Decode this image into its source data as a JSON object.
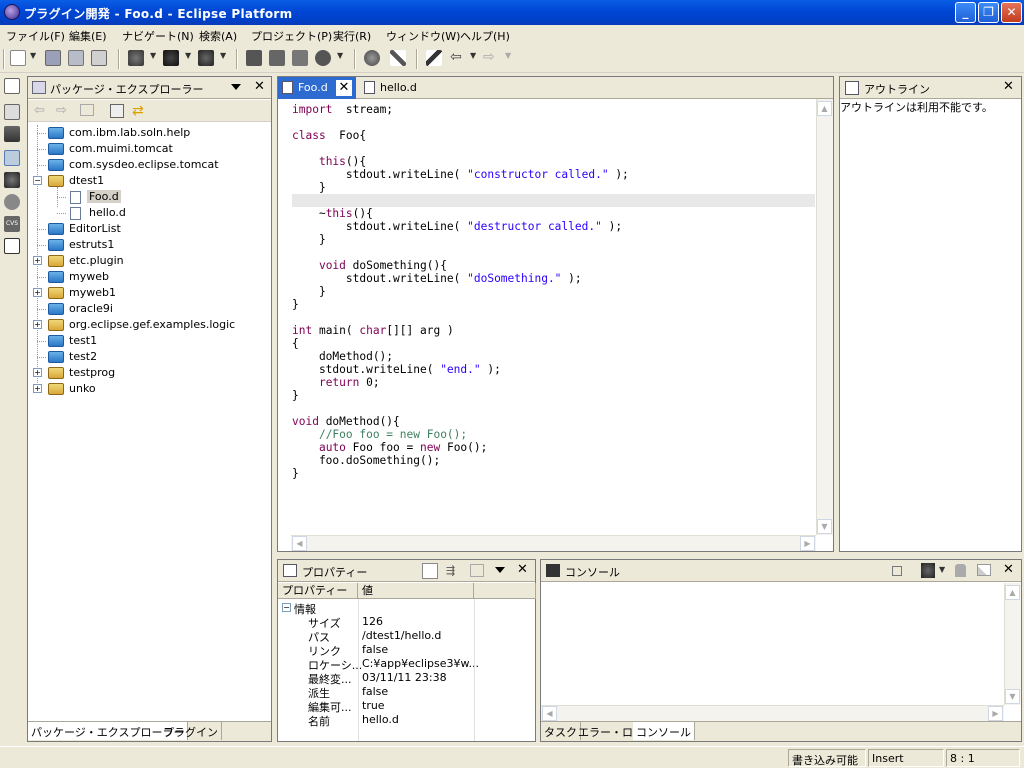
{
  "window": {
    "title": "プラグイン開発 - Foo.d - Eclipse Platform"
  },
  "menu": [
    "ファイル(F)",
    "編集(E)",
    "ナビゲート(N)",
    "検索(A)",
    "プロジェクト(P)",
    "実行(R)",
    "ウィンドウ(W)",
    "ヘルプ(H)"
  ],
  "explorer": {
    "title": "パッケージ・エクスプローラー",
    "items": [
      {
        "label": "com.ibm.lab.soln.help",
        "level": 0,
        "expand": "",
        "icon": "folder-icon"
      },
      {
        "label": "com.muimi.tomcat",
        "level": 0,
        "expand": "",
        "icon": "folder-icon"
      },
      {
        "label": "com.sysdeo.eclipse.tomcat",
        "level": 0,
        "expand": "",
        "icon": "folder-icon"
      },
      {
        "label": "dtest1",
        "level": 0,
        "expand": "−",
        "icon": "open-folder-icon"
      },
      {
        "label": "Foo.d",
        "level": 1,
        "expand": "",
        "icon": "file-icon",
        "selected": true
      },
      {
        "label": "hello.d",
        "level": 1,
        "expand": "",
        "icon": "file-icon"
      },
      {
        "label": "EditorList",
        "level": 0,
        "expand": "",
        "icon": "folder-icon"
      },
      {
        "label": "estruts1",
        "level": 0,
        "expand": "",
        "icon": "folder-icon"
      },
      {
        "label": "etc.plugin",
        "level": 0,
        "expand": "+",
        "icon": "java-project-icon"
      },
      {
        "label": "myweb",
        "level": 0,
        "expand": "",
        "icon": "folder-icon"
      },
      {
        "label": "myweb1",
        "level": 0,
        "expand": "+",
        "icon": "java-project-icon"
      },
      {
        "label": "oracle9i",
        "level": 0,
        "expand": "",
        "icon": "folder-icon"
      },
      {
        "label": "org.eclipse.gef.examples.logic",
        "level": 0,
        "expand": "+",
        "icon": "java-project-icon"
      },
      {
        "label": "test1",
        "level": 0,
        "expand": "",
        "icon": "folder-icon"
      },
      {
        "label": "test2",
        "level": 0,
        "expand": "",
        "icon": "folder-icon"
      },
      {
        "label": "testprog",
        "level": 0,
        "expand": "+",
        "icon": "java-project-icon"
      },
      {
        "label": "unko",
        "level": 0,
        "expand": "+",
        "icon": "java-project-icon"
      }
    ],
    "tabs": [
      "パッケージ・エクスプローラー",
      "プラグイン"
    ]
  },
  "editor": {
    "tabs": [
      {
        "label": "Foo.d",
        "active": true
      },
      {
        "label": "hello.d",
        "active": false
      }
    ],
    "lines": [
      [
        [
          "kw",
          "import"
        ],
        [
          "",
          "  stream;"
        ]
      ],
      [],
      [
        [
          "kw",
          "class"
        ],
        [
          "",
          "  Foo{"
        ]
      ],
      [],
      [
        [
          "",
          "    "
        ],
        [
          "kw",
          "this"
        ],
        [
          "",
          "(){"
        ]
      ],
      [
        [
          "",
          "        stdout.writeLine( "
        ],
        [
          "str",
          "\"constructor called.\""
        ],
        [
          "",
          " );"
        ]
      ],
      [
        [
          "",
          "    }"
        ]
      ],
      [],
      [
        [
          "",
          "    ~"
        ],
        [
          "kw",
          "this"
        ],
        [
          "",
          "(){"
        ]
      ],
      [
        [
          "",
          "        stdout.writeLine( "
        ],
        [
          "str",
          "\"destructor called.\""
        ],
        [
          "",
          " );"
        ]
      ],
      [
        [
          "",
          "    }"
        ]
      ],
      [],
      [
        [
          "",
          "    "
        ],
        [
          "kw",
          "void"
        ],
        [
          "",
          " doSomething(){"
        ]
      ],
      [
        [
          "",
          "        stdout.writeLine( "
        ],
        [
          "str",
          "\"doSomething.\""
        ],
        [
          "",
          " );"
        ]
      ],
      [
        [
          "",
          "    }"
        ]
      ],
      [
        [
          "",
          "}"
        ]
      ],
      [],
      [
        [
          "kw",
          "int"
        ],
        [
          "",
          " main( "
        ],
        [
          "kw",
          "char"
        ],
        [
          "",
          "[][] arg )"
        ]
      ],
      [
        [
          "",
          "{"
        ]
      ],
      [
        [
          "",
          "    doMethod();"
        ]
      ],
      [
        [
          "",
          "    stdout.writeLine( "
        ],
        [
          "str",
          "\"end.\""
        ],
        [
          "",
          " );"
        ]
      ],
      [
        [
          "",
          "    "
        ],
        [
          "kw",
          "return"
        ],
        [
          "",
          " 0;"
        ]
      ],
      [
        [
          "",
          "}"
        ]
      ],
      [],
      [
        [
          "kw",
          "void"
        ],
        [
          "",
          " doMethod(){"
        ]
      ],
      [
        [
          "",
          "    "
        ],
        [
          "cmt",
          "//Foo foo = new Foo();"
        ]
      ],
      [
        [
          "",
          "    "
        ],
        [
          "kw",
          "auto"
        ],
        [
          "",
          " Foo foo = "
        ],
        [
          "kw",
          "new"
        ],
        [
          "",
          " Foo();"
        ]
      ],
      [
        [
          "",
          "    foo.doSomething();"
        ]
      ],
      [
        [
          "",
          "}"
        ]
      ]
    ],
    "current_line": 7
  },
  "outline": {
    "title": "アウトライン",
    "message": "アウトラインは利用不能です。"
  },
  "properties": {
    "title": "プロパティー",
    "col_prop": "プロパティー",
    "col_value": "値",
    "group": "情報",
    "rows": [
      {
        "name": "サイズ",
        "value": "126"
      },
      {
        "name": "パス",
        "value": "/dtest1/hello.d"
      },
      {
        "name": "リンク",
        "value": "false"
      },
      {
        "name": "ロケーシ...",
        "value": "C:¥app¥eclipse3¥w..."
      },
      {
        "name": "最終変...",
        "value": "03/11/11 23:38"
      },
      {
        "name": "派生",
        "value": "false"
      },
      {
        "name": "編集可...",
        "value": "true"
      },
      {
        "name": "名前",
        "value": "hello.d"
      }
    ]
  },
  "console": {
    "title": "コンソール",
    "tabs": [
      "タスク",
      "エラー・ログ",
      "コンソール"
    ]
  },
  "status": {
    "writable": "書き込み可能",
    "mode": "Insert",
    "position": "8 : 1"
  },
  "colors": {
    "keyword": "#7f0055",
    "string": "#2a00ff",
    "comment": "#3f7f5f",
    "title_bar": "#0046d5"
  }
}
